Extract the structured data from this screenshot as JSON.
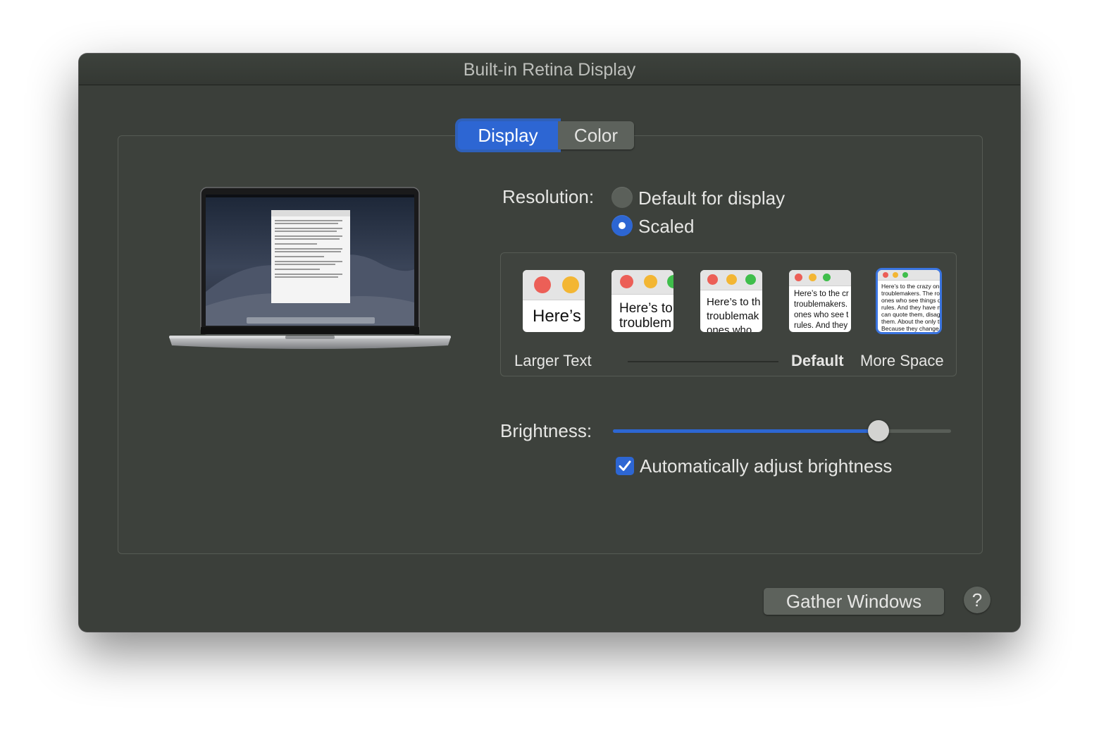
{
  "window": {
    "title": "Built-in Retina Display"
  },
  "tabs": [
    {
      "label": "Display",
      "selected": true
    },
    {
      "label": "Color",
      "selected": false
    }
  ],
  "resolution": {
    "label": "Resolution:",
    "options": [
      {
        "label": "Default for display",
        "selected": false
      },
      {
        "label": "Scaled",
        "selected": true
      }
    ],
    "scales": {
      "thumbnails": [
        {
          "text": "Here’s",
          "selected": false
        },
        {
          "text": "Here’s to\ntroublem",
          "selected": false
        },
        {
          "text": "Here’s to th\ntroublemak\nones who",
          "selected": false
        },
        {
          "text": "Here’s to the cr\ntroublemakers.\nones who see t\nrules. And they",
          "selected": false
        },
        {
          "text": "Here’s to the crazy one\ntroublemakers. The rou\nones who see things di\nrules. And they have no\ncan quote them, disagre\nthem. About the only th\nBecause they change t",
          "selected": true
        }
      ],
      "label_left": "Larger Text",
      "label_default": "Default",
      "label_right": "More Space"
    }
  },
  "brightness": {
    "label": "Brightness:",
    "level": 0.785,
    "auto_label": "Automatically adjust brightness",
    "auto_checked": true
  },
  "buttons": {
    "gather": "Gather Windows",
    "help": "?"
  },
  "colors": {
    "accent": "#2d66d3",
    "window_bg": "#3b3f3a"
  }
}
